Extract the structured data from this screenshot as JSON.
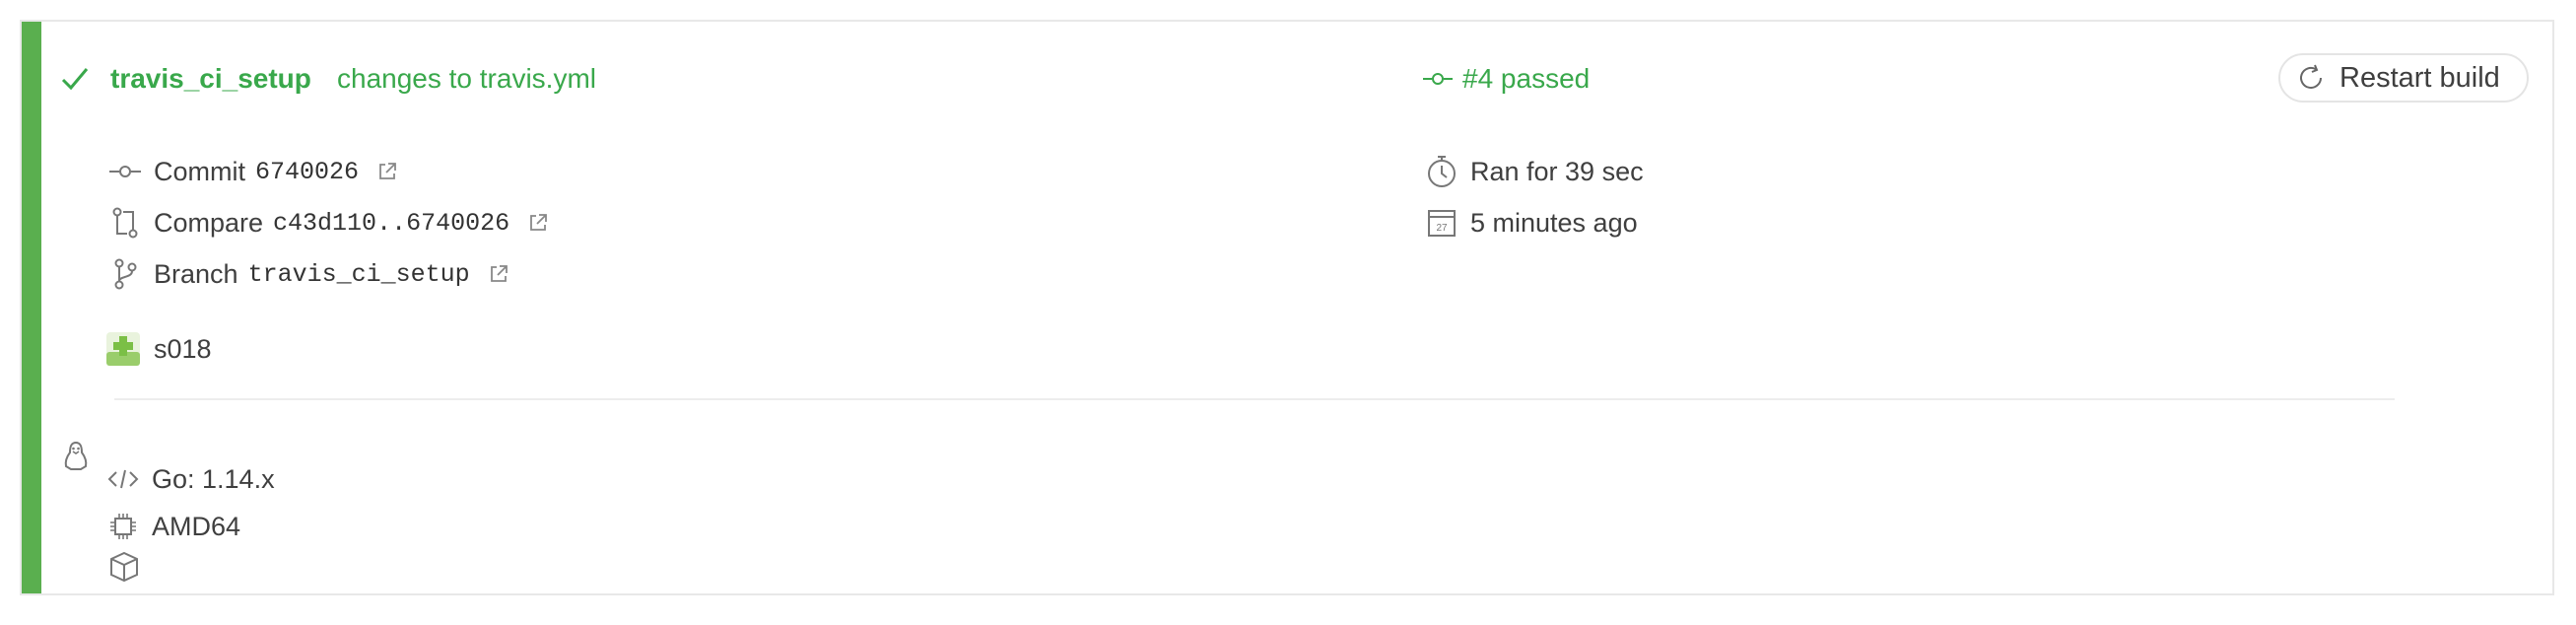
{
  "build": {
    "branch_name": "travis_ci_setup",
    "commit_message": "changes to travis.yml",
    "status_text": "#4 passed",
    "restart_label": "Restart build"
  },
  "details": {
    "commit_label": "Commit",
    "commit_hash": "6740026",
    "compare_label": "Compare",
    "compare_range": "c43d110..6740026",
    "branch_label": "Branch",
    "branch_value": "travis_ci_setup",
    "author": "s018"
  },
  "timing": {
    "duration": "Ran for 39 sec",
    "finished": "5 minutes ago",
    "calendar_day": "27"
  },
  "job": {
    "os_icon": "linux-penguin-icon",
    "language": "Go: 1.14.x",
    "arch": "AMD64"
  },
  "colors": {
    "passed": "#39a84b",
    "stripe": "#5aaf4f"
  }
}
